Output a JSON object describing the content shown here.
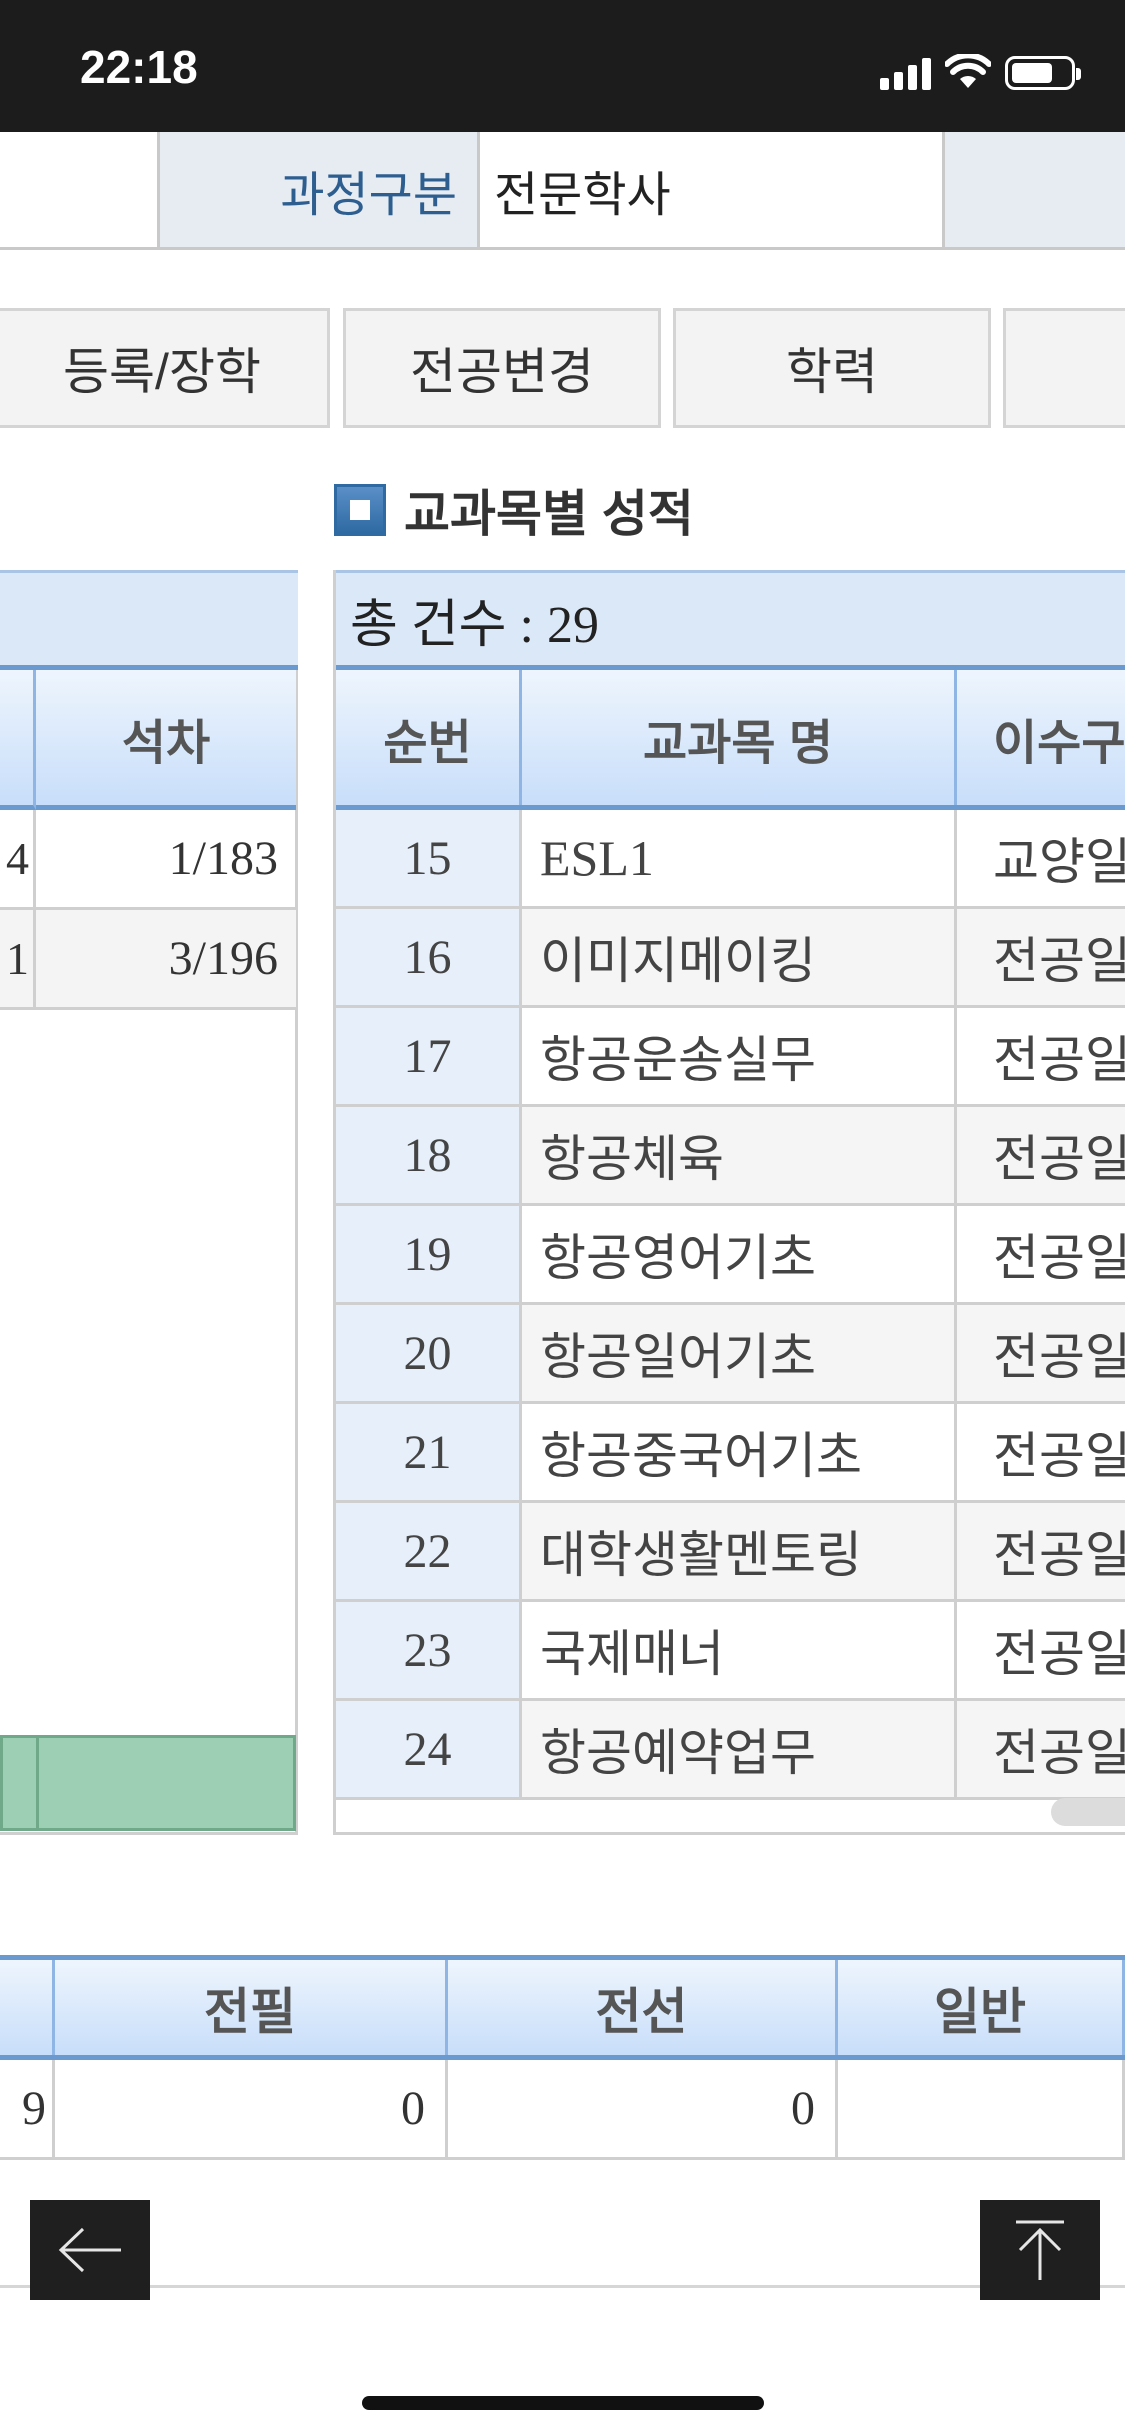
{
  "status_bar": {
    "time": "22:18",
    "icons": [
      "signal-icon",
      "wifi-icon",
      "battery-icon"
    ]
  },
  "course_info": {
    "label": "과정구분",
    "value": "전문학사"
  },
  "tabs": [
    {
      "label": "등록/장학"
    },
    {
      "label": "전공변경"
    },
    {
      "label": "학력"
    }
  ],
  "section_title": "교과목별 성적",
  "semester_table": {
    "header": "석차",
    "rows": [
      {
        "partial": "4",
        "rank": "1/183"
      },
      {
        "partial": "1",
        "rank": "3/196"
      }
    ]
  },
  "subject_table": {
    "total_count": "총 건수 : 29",
    "columns": [
      "순번",
      "교과목 명",
      "이수구"
    ],
    "rows": [
      {
        "no": "15",
        "name": "ESL1",
        "type": "교양일"
      },
      {
        "no": "16",
        "name": "이미지메이킹",
        "type": "전공일"
      },
      {
        "no": "17",
        "name": "항공운송실무",
        "type": "전공일"
      },
      {
        "no": "18",
        "name": "항공체육",
        "type": "전공일"
      },
      {
        "no": "19",
        "name": "항공영어기초",
        "type": "전공일"
      },
      {
        "no": "20",
        "name": "항공일어기초",
        "type": "전공일"
      },
      {
        "no": "21",
        "name": "항공중국어기초",
        "type": "전공일"
      },
      {
        "no": "22",
        "name": "대학생활멘토링",
        "type": "전공일"
      },
      {
        "no": "23",
        "name": "국제매너",
        "type": "전공일"
      },
      {
        "no": "24",
        "name": "항공예약업무",
        "type": "전공일"
      }
    ]
  },
  "summary_table": {
    "columns": [
      "전필",
      "전선",
      "일반"
    ],
    "values": [
      "9",
      "0",
      "0",
      ""
    ]
  },
  "colors": {
    "accent": "#6a9ad0",
    "header_bg": "#dbe8f8",
    "label_text": "#2d5e8f",
    "footer_green": "#9ccfb4"
  }
}
